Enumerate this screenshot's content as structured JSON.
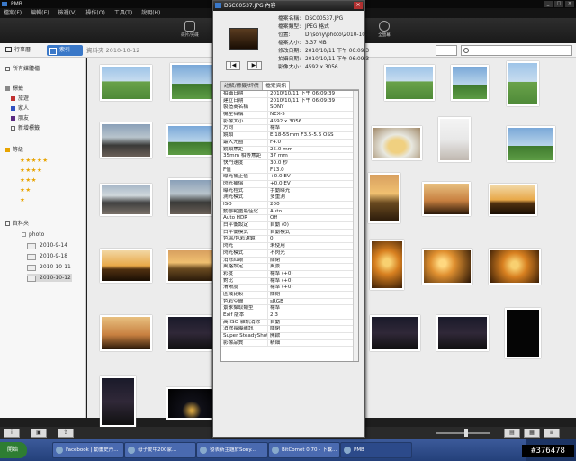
{
  "app": {
    "title": "PMB"
  },
  "menu": [
    "檔案(F)",
    "編輯(E)",
    "檢視(V)",
    "操作(O)",
    "工具(T)",
    "說明(H)"
  ],
  "toolbar": {
    "tool1": "碟片/光碟",
    "tool2": "匯入/匯出",
    "tool3": "全螢幕"
  },
  "nav": {
    "calendar": "行事曆",
    "view": "索引",
    "breadcrumb": "資料夾   2010-10-12",
    "search_placeholder": ""
  },
  "sidebar": {
    "all_media": "所有媒體檔",
    "tags_header": "標籤",
    "tags": [
      {
        "label": "旅遊",
        "color": "#c03030"
      },
      {
        "label": "家人",
        "color": "#3050c0"
      },
      {
        "label": "朋友",
        "color": "#5a2a80"
      }
    ],
    "new_tag": "新增標籤",
    "rating_header": "等級",
    "ratings": [
      "★★★★★",
      "★★★★",
      "★★★",
      "★★",
      "★"
    ],
    "folders_header": "資料夾",
    "folder_root": "photo",
    "dates": [
      "2010-9-14",
      "2010-9-18",
      "2010-10-11",
      "2010-10-12"
    ]
  },
  "dialog": {
    "title": "DSC00537.JPG 內容",
    "info": [
      {
        "key": "檔案名稱:",
        "value": "DSC00537.JPG"
      },
      {
        "key": "檔案類型:",
        "value": "JPEG 格式"
      },
      {
        "key": "位置:",
        "value": "D:\\sony\\photo\\2010-10-1"
      },
      {
        "key": "檔案大小:",
        "value": "3.37 MB"
      },
      {
        "key": "修改日期:",
        "value": "2010/10/11 下午 06:09:3"
      },
      {
        "key": "拍攝日期:",
        "value": "2010/10/11 下午 06:09:3"
      },
      {
        "key": "影像大小:",
        "value": "4592 x 3056"
      }
    ],
    "tabs": [
      "註解/標籤/評價",
      "檔案資訊"
    ],
    "properties": [
      {
        "key": "拍攝日期",
        "value": "2010/10/11 下午 06:09:39"
      },
      {
        "key": "建立日期",
        "value": "2010/10/11 下午 06:09:39"
      },
      {
        "key": "製造商名稱",
        "value": "SONY"
      },
      {
        "key": "機型名稱",
        "value": "NEX-5"
      },
      {
        "key": "影像大小",
        "value": "4592 x 3056"
      },
      {
        "key": "方向",
        "value": "標準"
      },
      {
        "key": "鏡頭",
        "value": "E 18-55mm F3.5-5.6 OSS"
      },
      {
        "key": "最大光圈",
        "value": "F4.0"
      },
      {
        "key": "鏡頭焦距",
        "value": "25.0 mm"
      },
      {
        "key": "35mm 相等焦距",
        "value": "37 mm"
      },
      {
        "key": "快門速度",
        "value": "30.0 秒"
      },
      {
        "key": "F值",
        "value": "F13.0"
      },
      {
        "key": "曝光補正值",
        "value": "+0.0 EV"
      },
      {
        "key": "閃光補償",
        "value": "+0.0 EV"
      },
      {
        "key": "曝光程式",
        "value": "手動曝光"
      },
      {
        "key": "測光模式",
        "value": "多重測"
      },
      {
        "key": "ISO",
        "value": "200"
      },
      {
        "key": "動態範圍最佳化",
        "value": "Auto"
      },
      {
        "key": "Auto HDR",
        "value": "Off"
      },
      {
        "key": "白平衡設定",
        "value": "自動 (0)"
      },
      {
        "key": "白平衡模式",
        "value": "自動模式"
      },
      {
        "key": "色溫/色彩濾鏡",
        "value": "0"
      },
      {
        "key": "閃光",
        "value": "未使用"
      },
      {
        "key": "閃光模式",
        "value": "不閃光"
      },
      {
        "key": "消除紅眼",
        "value": "關閉"
      },
      {
        "key": "風格設定",
        "value": "風景"
      },
      {
        "key": "彩度",
        "value": "標準 (+0)"
      },
      {
        "key": "對比",
        "value": "標準 (+0)"
      },
      {
        "key": "清晰度",
        "value": "標準 (+0)"
      },
      {
        "key": "區域比較",
        "value": "關閉"
      },
      {
        "key": "色彩空間",
        "value": "sRGB"
      },
      {
        "key": "景象擷取類型",
        "value": "標準"
      },
      {
        "key": "Exif 版本",
        "value": "2.3"
      },
      {
        "key": "高 ISO 雜訊消除",
        "value": "自動"
      },
      {
        "key": "消除長曝雜訊",
        "value": "關閉"
      },
      {
        "key": "Super SteadyShot",
        "value": "開啟"
      },
      {
        "key": "影像品質",
        "value": "精細"
      }
    ]
  },
  "taskbar": {
    "start": "開始",
    "tasks": [
      "Facebook | 動畫史丹...",
      "母子爱中200家...",
      "發表新主題於Sony...",
      "BitComet 0.70 - 下載...",
      "PMB"
    ],
    "clock": "下午 06:14"
  },
  "watermark": "#376478",
  "colors": {
    "accent": "#3a78c8",
    "taskbar": "#24407a"
  }
}
